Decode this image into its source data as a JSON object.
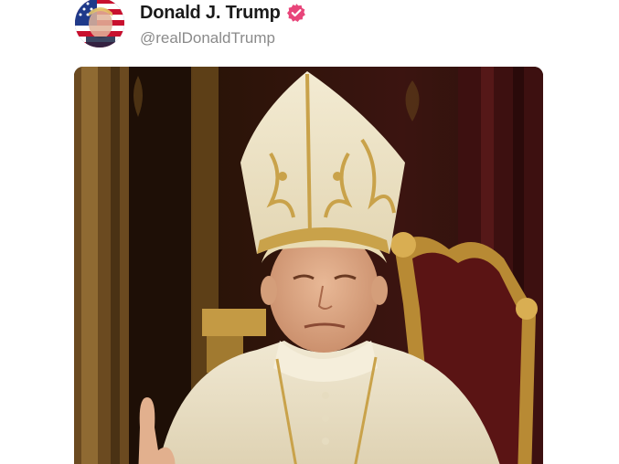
{
  "post": {
    "author": {
      "display_name": "Donald J. Trump",
      "handle": "@realDonaldTrump",
      "verified": true,
      "verified_badge_color": "#e8457a",
      "avatar_icon": "user-avatar-flag"
    },
    "media": {
      "type": "image",
      "icon": "ai-generated-portrait",
      "colors": {
        "background": "#2b1408",
        "robe": "#ece3cb",
        "gold": "#c9a24a"
      }
    }
  }
}
